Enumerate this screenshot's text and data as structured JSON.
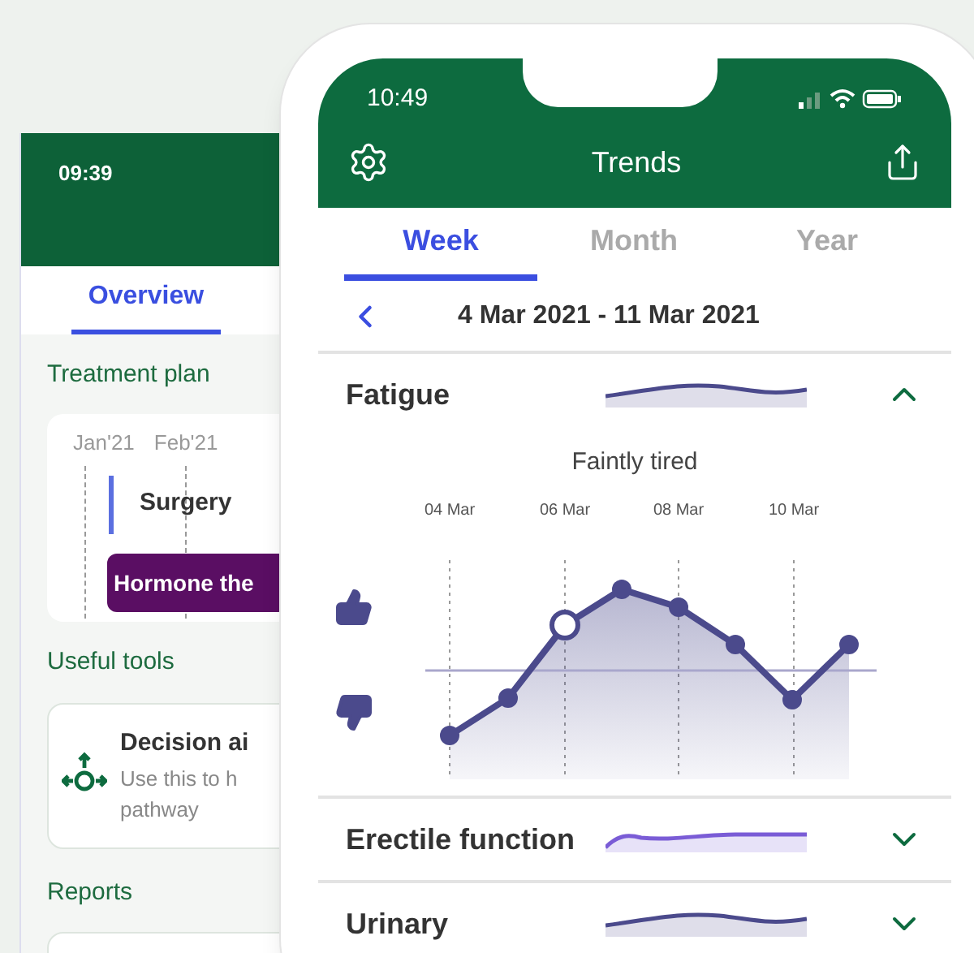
{
  "back_phone": {
    "status_time": "09:39",
    "tabs": [
      {
        "label": "Overview",
        "selected": true
      }
    ],
    "treatment_plan": {
      "heading": "Treatment plan",
      "months": [
        "Jan'21",
        "Feb'21"
      ],
      "events": [
        {
          "label": "Surgery",
          "kind": "marker"
        },
        {
          "label": "Hormone the",
          "kind": "bar"
        }
      ]
    },
    "useful_tools": {
      "heading": "Useful tools",
      "card": {
        "title": "Decision ai",
        "description": "Use this to h",
        "description_2": "pathway"
      }
    },
    "reports": {
      "heading": "Reports"
    }
  },
  "front_phone": {
    "status_time": "10:49",
    "title": "Trends",
    "tabs": [
      {
        "label": "Week",
        "selected": true
      },
      {
        "label": "Month",
        "selected": false
      },
      {
        "label": "Year",
        "selected": false
      }
    ],
    "date_range": "4 Mar 2021 - 11 Mar 2021",
    "sections": [
      {
        "title": "Fatigue",
        "expanded": true,
        "color": "#4b4a8c",
        "detail": {
          "caption": "Faintly tired",
          "dates": [
            "04 Mar",
            "06 Mar",
            "08 Mar",
            "10 Mar"
          ]
        }
      },
      {
        "title": "Erectile function",
        "expanded": false,
        "color": "#7a5cd6"
      },
      {
        "title": "Urinary",
        "expanded": false,
        "color": "#4b4a8c"
      }
    ]
  }
}
